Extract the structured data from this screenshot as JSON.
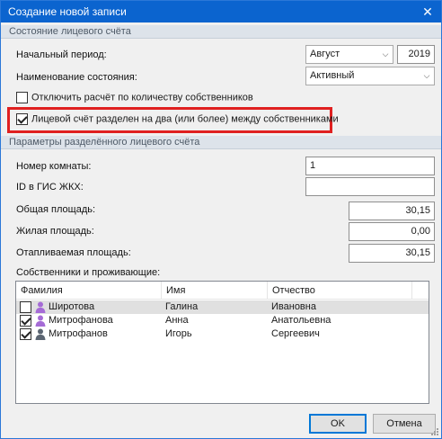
{
  "window": {
    "title": "Создание новой записи"
  },
  "account_state": {
    "header": "Состояние лицевого счёта",
    "start_period_label": "Начальный период:",
    "month_value": "Август",
    "year_value": "2019",
    "state_name_label": "Наименование состояния:",
    "state_value": "Активный",
    "disable_calc_label": "Отключить расчёт по количеству собственников",
    "disable_calc_checked": false,
    "split_label": "Лицевой счёт разделен на два (или более) между собственниками",
    "split_checked": true
  },
  "split_params": {
    "header": "Параметры разделённого лицевого счёта",
    "room_label": "Номер комнаты:",
    "room_value": "1",
    "gis_label": "ID в ГИС ЖКХ:",
    "gis_value": "",
    "total_area_label": "Общая площадь:",
    "total_area_value": "30,15",
    "living_area_label": "Жилая площадь:",
    "living_area_value": "0,00",
    "heated_area_label": "Отапливаемая площадь:",
    "heated_area_value": "30,15",
    "owners_label": "Собственники и проживающие:"
  },
  "owners_table": {
    "columns": [
      "Фамилия",
      "Имя",
      "Отчество"
    ],
    "rows": [
      {
        "surname": "Широтова",
        "name": "Галина",
        "patronymic": "Ивановна",
        "checked": false,
        "selected": true,
        "icon": "person-female-icon",
        "icon_color": "#a56bd6"
      },
      {
        "surname": "Митрофанова",
        "name": "Анна",
        "patronymic": "Анатольевна",
        "checked": true,
        "selected": false,
        "icon": "person-female-icon",
        "icon_color": "#a56bd6"
      },
      {
        "surname": "Митрофанов",
        "name": "Игорь",
        "patronymic": "Сергеевич",
        "checked": true,
        "selected": false,
        "icon": "person-male-icon",
        "icon_color": "#5b6572"
      }
    ]
  },
  "buttons": {
    "ok": "OK",
    "cancel": "Отмена"
  },
  "colors": {
    "titlebar": "#0b64cf",
    "highlight": "#e02020",
    "section_header": "#dde3ea"
  }
}
